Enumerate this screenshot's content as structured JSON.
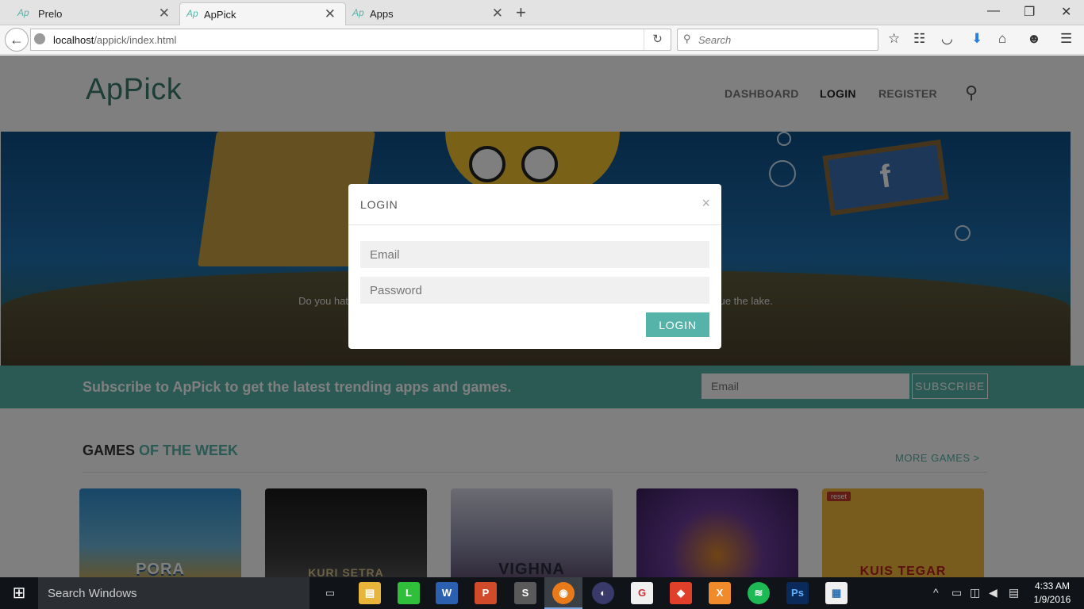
{
  "tabs": [
    {
      "favicon": "Ap",
      "label": "Prelo",
      "close": "✕"
    },
    {
      "favicon": "Ap",
      "label": "ApPick",
      "close": "✕"
    },
    {
      "favicon": "Ap",
      "label": "Apps",
      "close": "✕"
    }
  ],
  "new_tab": "+",
  "window_controls": {
    "minimize": "—",
    "maximize": "❐",
    "close": "✕"
  },
  "address": {
    "host": "localhost",
    "path": "/appick/index.html"
  },
  "search": {
    "placeholder": "Search"
  },
  "site": {
    "logo": "ApPick",
    "menu": {
      "dashboard": "DASHBOARD",
      "login": "LOGIN",
      "register": "REGISTER"
    },
    "hero_caption": "Do you hate rubbish? So do I! Help Pora the duck collect rubbish with his bubble gun to rescue the lake.",
    "hero_sign": "f"
  },
  "subscribe": {
    "message": "Subscribe to ApPick to get the latest trending apps and games.",
    "email_placeholder": "Email",
    "button": "SUBSCRIBE"
  },
  "games": {
    "title_plain": "GAMES",
    "title_accent": " OF THE WEEK",
    "more": "MORE GAMES >",
    "cards": [
      {
        "title": "PORA",
        "badge": ""
      },
      {
        "title": "KURI SETRA",
        "badge": ""
      },
      {
        "title": "VIGHNA",
        "badge": ""
      },
      {
        "title": "",
        "badge": ""
      },
      {
        "title": "KUIS TEGAR",
        "badge": "reset"
      }
    ]
  },
  "modal": {
    "title": "LOGIN",
    "close": "×",
    "email_placeholder": "Email",
    "password_placeholder": "Password",
    "button": "LOGIN"
  },
  "taskbar": {
    "search_placeholder": "Search Windows",
    "time": "4:33 AM",
    "date": "1/9/2016"
  },
  "colors": {
    "accent": "#56b3a9",
    "logo": "#3a7a6e",
    "taskbar": "#101318"
  }
}
